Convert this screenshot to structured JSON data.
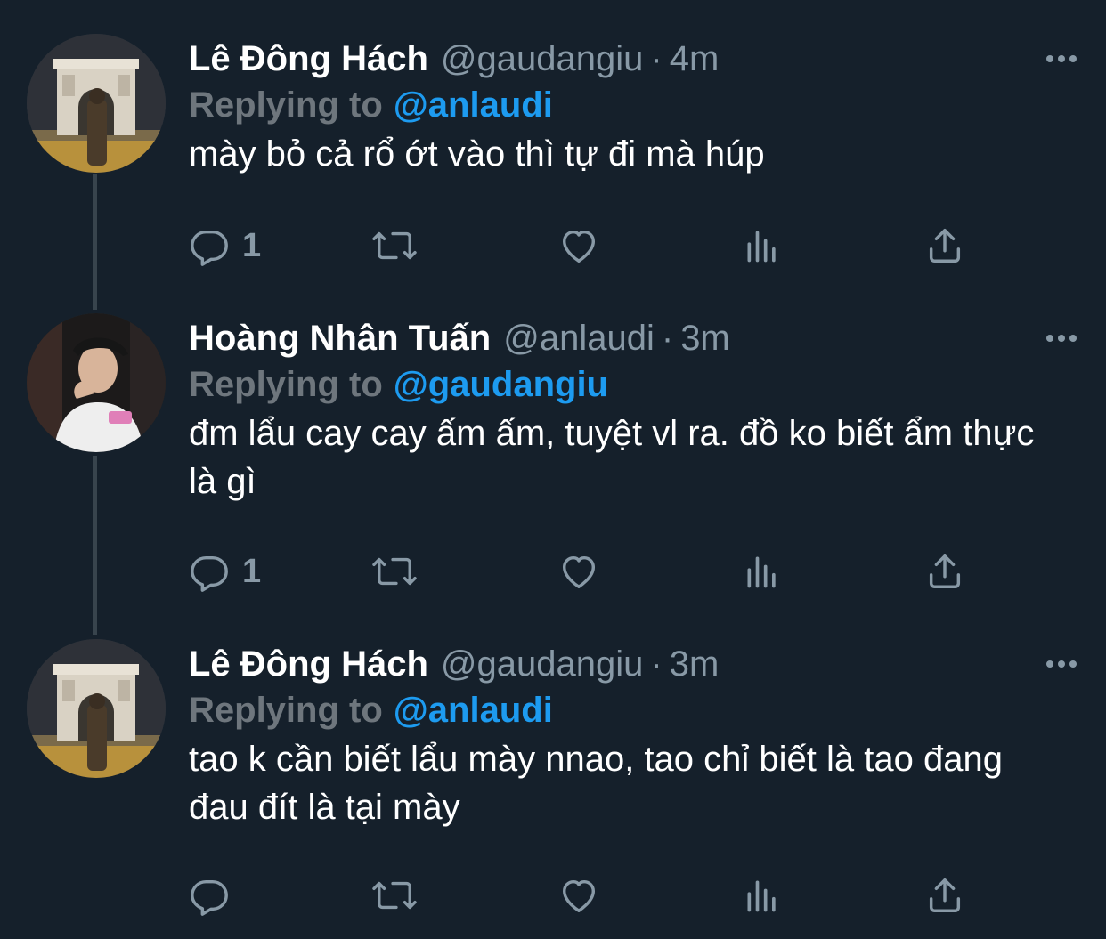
{
  "tweets": [
    {
      "name": "Lê Đông Hách",
      "handle": "@gaudangiu",
      "separator": "·",
      "time": "4m",
      "replying_label": "Replying to",
      "replying_to": "@anlaudi",
      "text": "mày bỏ cả rổ ớt vào thì tự đi mà húp",
      "reply_count": "1",
      "avatar": "arc-de-triomphe-avatar"
    },
    {
      "name": "Hoàng Nhân Tuấn",
      "handle": "@anlaudi",
      "separator": "·",
      "time": "3m",
      "replying_label": "Replying to",
      "replying_to": "@gaudangiu",
      "text": "đm lẩu cay cay ấm ấm, tuyệt vl ra. đồ ko biết ẩm thực là gì",
      "reply_count": "1",
      "avatar": "cap-white-shirt-avatar"
    },
    {
      "name": "Lê Đông Hách",
      "handle": "@gaudangiu",
      "separator": "·",
      "time": "3m",
      "replying_label": "Replying to",
      "replying_to": "@anlaudi",
      "text": "tao k cần biết lẩu mày nnao, tao chỉ biết là tao đang đau đít là tại mày",
      "reply_count": "",
      "avatar": "arc-de-triomphe-avatar"
    }
  ],
  "icons": {
    "reply": "reply-icon",
    "retweet": "retweet-icon",
    "like": "heart-icon",
    "analytics": "analytics-icon",
    "share": "share-icon",
    "more": "more-icon"
  },
  "colors": {
    "background": "#15202b",
    "text": "#ffffff",
    "secondary": "#8899a6",
    "accent": "#1d9bf0",
    "thread_line": "#38444d"
  }
}
